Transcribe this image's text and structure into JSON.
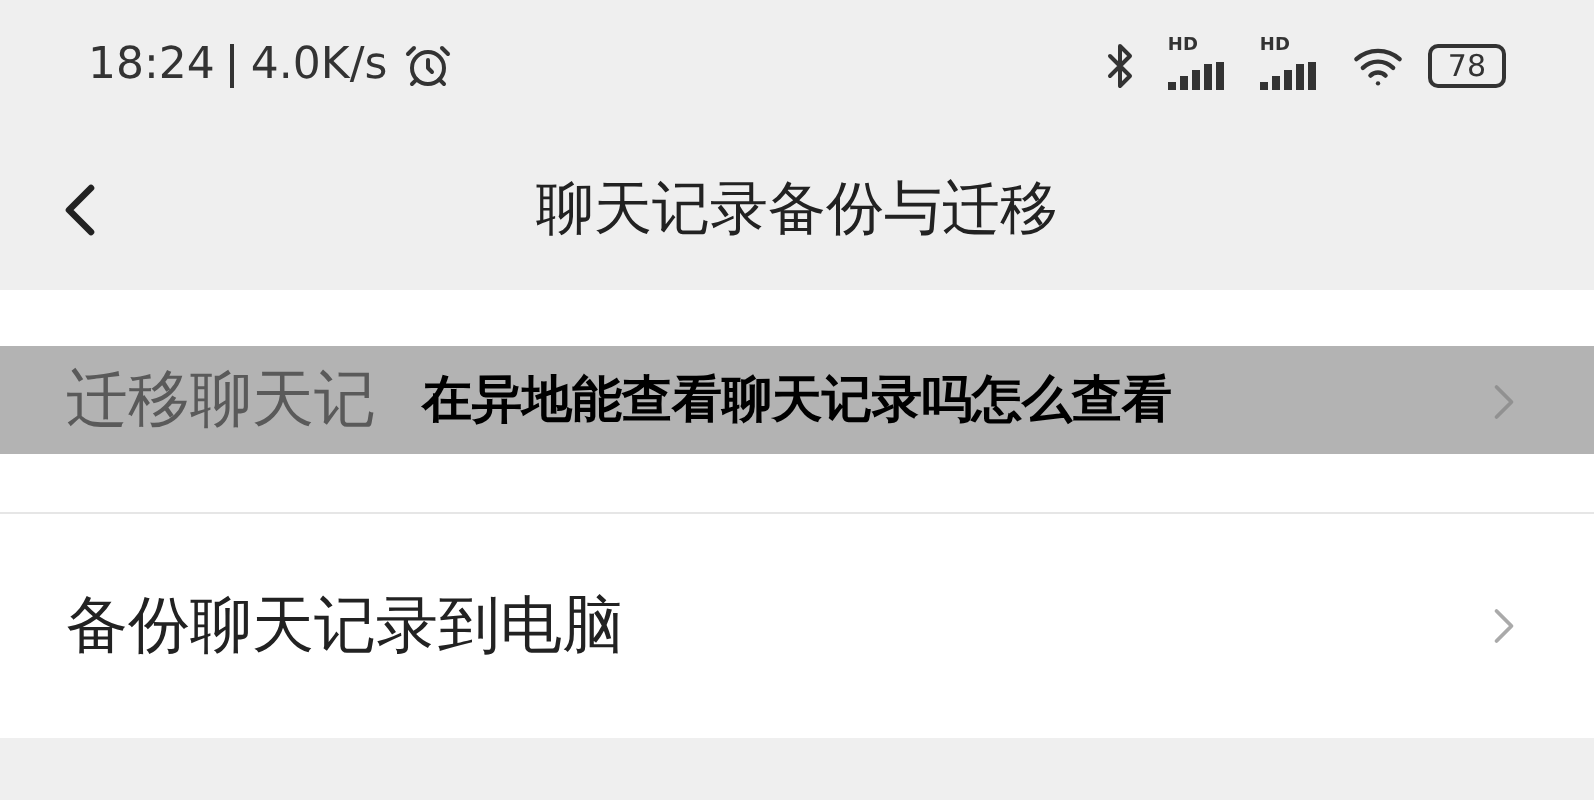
{
  "status_bar": {
    "time": "18:24",
    "speed": "4.0K/s",
    "battery": "78",
    "signals": [
      {
        "label": "HD"
      },
      {
        "label": "HD"
      }
    ]
  },
  "header": {
    "title": "聊天记录备份与迁移"
  },
  "rows": [
    {
      "label": "迁移聊天记"
    },
    {
      "label": "备份聊天记录到电脑"
    }
  ],
  "banner": {
    "text": "在异地能查看聊天记录吗怎么查看"
  }
}
